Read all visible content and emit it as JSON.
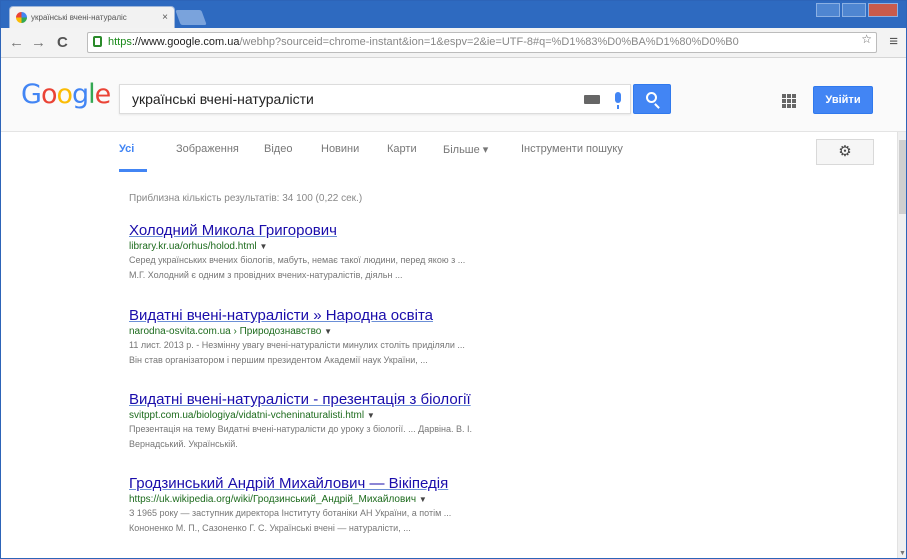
{
  "browser": {
    "tab_title": "українські вчені-натураліс",
    "tab_close": "×",
    "back": "←",
    "forward": "→",
    "reload": "C",
    "url_scheme": "https",
    "url_host": "://www.google.com.ua",
    "url_rest": "/webhp?sourceid=chrome-instant&ion=1&espv=2&ie=UTF-8#q=%D1%83%D0%BA%D1%80%D0%B0",
    "bookmark_star": "☆",
    "menu": "≡"
  },
  "google": {
    "logo_letters": [
      "G",
      "o",
      "o",
      "g",
      "l",
      "e"
    ],
    "query": "українські вчені-натуралісти",
    "signin_label": "Увійти"
  },
  "tabs": {
    "all": "Усі",
    "images": "Зображення",
    "video": "Відео",
    "news": "Новини",
    "maps": "Карти",
    "more": "Більше ▾",
    "tools": "Інструменти пошуку"
  },
  "stats": "Приблизна кількість результатів: 34 100 (0,22 сек.)",
  "results": [
    {
      "title": "Холодний Микола Григорович",
      "url": "library.kr.ua/orhus/holod.html",
      "snippet1": "Серед українських вчених біологів, мабуть, немає такої людини, перед якою з ...",
      "snippet2": "М.Г. Холодний є одним з провідних вчених-натуралістів, діяльн ..."
    },
    {
      "title": "Видатні вчені-натуралісти » Народна освіта",
      "url": "narodna-osvita.com.ua › Природознавство",
      "snippet1": "11 лист. 2013 р. - Незмінну увагу вчені-натуралісти минулих століть приділяли ...",
      "snippet2": "Він став організатором і першим президентом Академії наук України, ..."
    },
    {
      "title": "Видатні вчені-натуралісти - презентація з біології",
      "url": "svitppt.com.ua/biologiya/vidatni-vcheninaturalisti.html",
      "snippet1": "Презентація на тему Видатні вчені-натуралісти до уроку з біології. ... Дарвіна. В. І.",
      "snippet2": "Вернадський. Українській."
    },
    {
      "title": "Гродзинський Андрій Михайлович — Вікіпедія",
      "url": "https://uk.wikipedia.org/wiki/Гродзинський_Андрій_Михайлович",
      "snippet1": "З 1965 року — заступник директора Інституту ботаніки АН України, а потім ...",
      "snippet2": "Кононенко М. П., Сазоненко Г. С. Українські вчені — натуралісти, ..."
    }
  ]
}
